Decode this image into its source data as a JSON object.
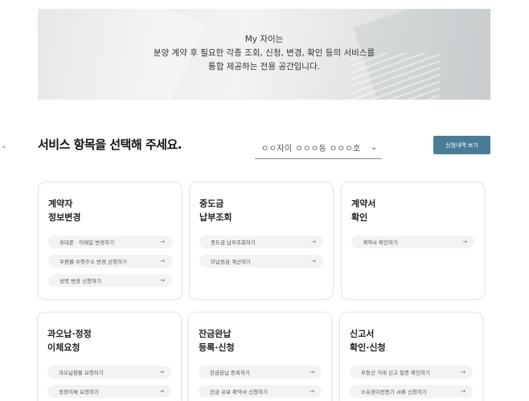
{
  "banner": {
    "lines": [
      "My 자이는",
      "분양 계약 후 필요한 각종 조회, 신청, 변경, 확인 등의 서비스를",
      "통합 제공하는 전용 공간입니다."
    ]
  },
  "section": {
    "title": "서비스 항목을 선택해 주세요.",
    "unit_select_value": "ㅇㅇ자이 ㅇㅇㅇ동 ㅇㅇㅇ호",
    "history_button": "신청내역 보기"
  },
  "cards": [
    {
      "title": [
        "계약자",
        "정보변경"
      ],
      "links": [
        "휴대폰 · 이메일 변경하기",
        "우편물 수령주소 변경 신청하기",
        "성명 변경 신청하기"
      ]
    },
    {
      "title": [
        "중도금",
        "납부조회"
      ],
      "links": [
        "중도금 납부조회하기",
        "미납원금 계산하기"
      ]
    },
    {
      "title": [
        "계약서",
        "확인"
      ],
      "links": [
        "계약서 확인하기"
      ]
    },
    {
      "title": [
        "과오납·정정",
        "이체요청"
      ],
      "links": [
        "과오납환불 요청하기",
        "정정이체 요청하기"
      ]
    },
    {
      "title": [
        "잔금완납",
        "등록·신청"
      ],
      "links": [
        "잔금완납 등록하기",
        "잔금 유보 확약서 신청하기"
      ]
    },
    {
      "title": [
        "신고서",
        "확인·신청"
      ],
      "links": [
        "부동산 거래 신고 필증 확인하기",
        "소유권이전등기 서류 신청하기"
      ]
    }
  ],
  "icons": {
    "arrow": "arrow-right-icon",
    "chevron": "chevron-down-icon"
  },
  "colors": {
    "accent": "#4a7d95"
  }
}
